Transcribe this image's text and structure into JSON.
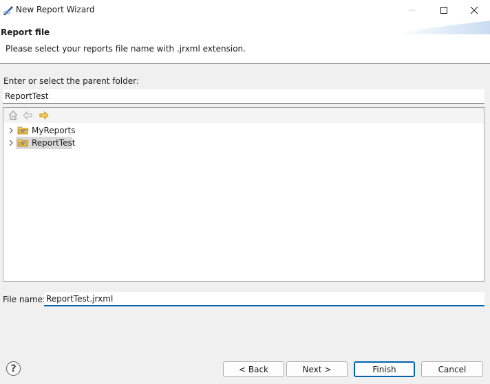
{
  "window": {
    "title": "New Report Wizard",
    "app_icon": "pen-icon",
    "controls": [
      "minimize-icon",
      "maximize-icon",
      "close-icon"
    ]
  },
  "header": {
    "title": "Report file",
    "description": "Please select your reports file name with .jrxml extension."
  },
  "parent_folder": {
    "label": "Enter or select the parent folder:",
    "value": "ReportTest"
  },
  "tree": {
    "toolbar": [
      "home-icon",
      "back-arrow-icon",
      "forward-arrow-icon"
    ],
    "items": [
      {
        "label": "MyReports",
        "selected": false
      },
      {
        "label": "ReportTest",
        "selected": true
      }
    ]
  },
  "file_name": {
    "label": "File name:",
    "value": "ReportTest.jrxml"
  },
  "footer": {
    "help_label": "?",
    "back_label": "< Back",
    "next_label": "Next >",
    "finish_label": "Finish",
    "cancel_label": "Cancel"
  },
  "colors": {
    "accent": "#0063b1",
    "folder": "#e8b64a"
  }
}
